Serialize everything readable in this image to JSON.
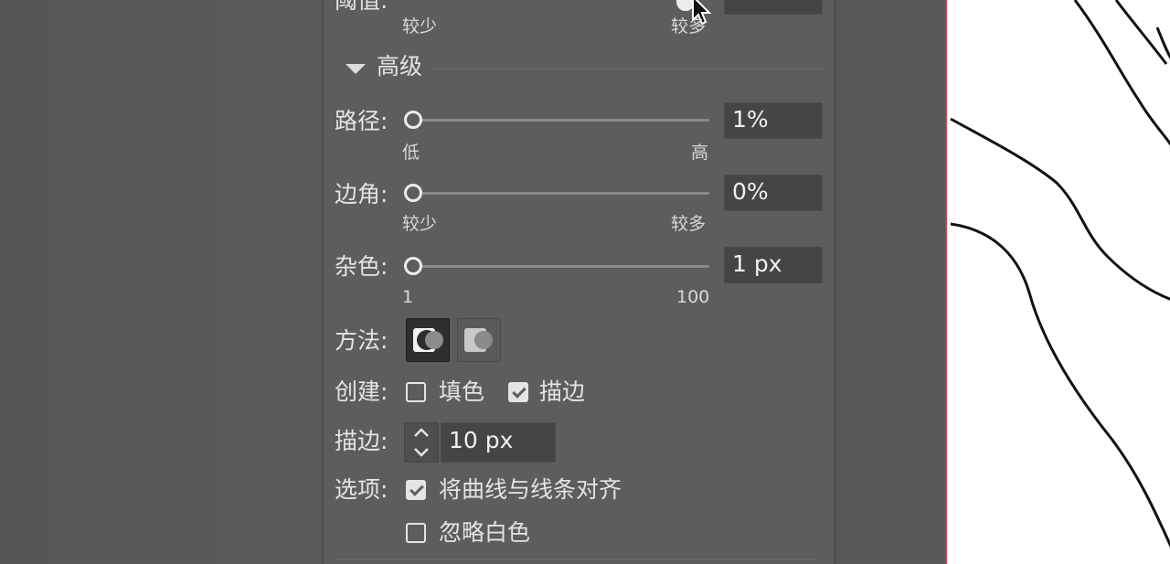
{
  "partial_top": {
    "label": "阈值:",
    "min_label": "较少",
    "max_label": "较多"
  },
  "advanced": {
    "title": "高级"
  },
  "paths": {
    "label": "路径:",
    "value": "1%",
    "min_label": "低",
    "max_label": "高",
    "level": 0
  },
  "corners": {
    "label": "边角:",
    "value": "0%",
    "min_label": "较少",
    "max_label": "较多",
    "level": 0
  },
  "noise": {
    "label": "杂色:",
    "value": "1 px",
    "min_label": "1",
    "max_label": "100",
    "level": 0
  },
  "method": {
    "label": "方法:",
    "options": [
      "abutting-method-icon",
      "overlapping-method-icon"
    ],
    "selected": 0
  },
  "create": {
    "label": "创建:",
    "fill_label": "填色",
    "fill_checked": false,
    "stroke_label": "描边",
    "stroke_checked": true
  },
  "stroke": {
    "label": "描边:",
    "value": "10 px"
  },
  "options": {
    "label": "选项:",
    "snap_label": "将曲线与线条对齐",
    "snap_checked": true,
    "ignore_white_label": "忽略白色",
    "ignore_white_checked": false
  },
  "colors": {
    "panel_bg": "#5d5d5d",
    "field_bg": "#454545",
    "text": "#e4e4e4",
    "artboard_border": "#d63b3b"
  }
}
